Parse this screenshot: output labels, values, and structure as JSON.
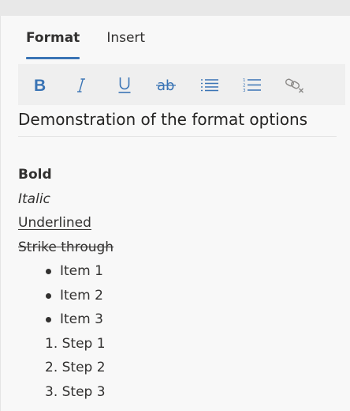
{
  "tabs": [
    {
      "label": "Format",
      "active": true
    },
    {
      "label": "Insert",
      "active": false
    }
  ],
  "toolbar": {
    "buttons": [
      {
        "name": "bold",
        "icon": "bold-icon",
        "glyph": "B"
      },
      {
        "name": "italic",
        "icon": "italic-icon",
        "glyph": "I"
      },
      {
        "name": "underline",
        "icon": "underline-icon",
        "glyph": "U"
      },
      {
        "name": "strikethrough",
        "icon": "strikethrough-icon",
        "glyph": "ab"
      },
      {
        "name": "bulleted-list",
        "icon": "bulleted-list-icon"
      },
      {
        "name": "numbered-list",
        "icon": "numbered-list-icon"
      },
      {
        "name": "remove-link",
        "icon": "unlink-icon"
      }
    ]
  },
  "document": {
    "title": "Demonstration of the format options",
    "bold_text": "Bold",
    "italic_text": "Italic",
    "underlined_text": "Underlined",
    "strike_text": "Strike through",
    "bullets": [
      "Item 1",
      "Item 2",
      "Item 3"
    ],
    "steps": [
      {
        "num": "1.",
        "text": "Step 1"
      },
      {
        "num": "2.",
        "text": "Step 2"
      },
      {
        "num": "3.",
        "text": "Step 3"
      }
    ]
  },
  "colors": {
    "accent": "#3a74b5",
    "disabled_icon": "#8a8886",
    "text": "#323130"
  }
}
